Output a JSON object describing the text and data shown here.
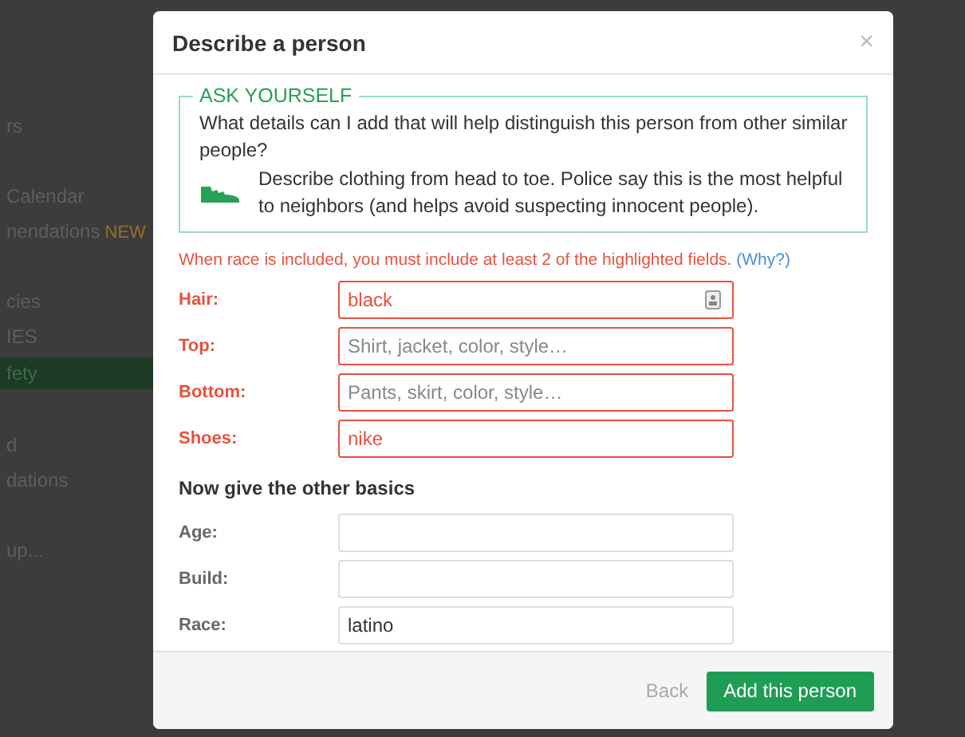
{
  "background_sidebar": {
    "groups": [
      {
        "items": [
          {
            "label": "rs",
            "selected": false
          }
        ]
      },
      {
        "items": [
          {
            "label": "Calendar",
            "selected": false
          },
          {
            "label": "nendations",
            "badge": "NEW",
            "selected": false
          }
        ]
      },
      {
        "items": [
          {
            "label": "cies",
            "selected": false
          },
          {
            "label": "IES",
            "selected": false
          },
          {
            "label": "fety",
            "selected": true
          }
        ]
      },
      {
        "items": [
          {
            "label": "d",
            "selected": false
          },
          {
            "label": "dations",
            "selected": false
          }
        ]
      },
      {
        "items": [
          {
            "label": "up...",
            "selected": false
          }
        ]
      }
    ]
  },
  "dialog": {
    "title": "Describe a person",
    "close": "×",
    "tip": {
      "legend": "ASK YOURSELF",
      "question": "What details can I add that will help distinguish this person from other similar people?",
      "hint": "Describe clothing from head to toe. Police say this is the most helpful to neighbors (and helps avoid suspecting innocent people)."
    },
    "warning": {
      "text": "When race is included, you must include at least 2 of the highlighted fields.",
      "link": "(Why?)"
    },
    "highlighted_fields": [
      {
        "label": "Hair:",
        "value": "black",
        "kind": "autofill",
        "highlighted": true
      },
      {
        "label": "Top:",
        "placeholder": "Shirt, jacket, color, style…",
        "kind": "text",
        "highlighted": true
      },
      {
        "label": "Bottom:",
        "placeholder": "Pants, skirt, color, style…",
        "kind": "text",
        "highlighted": true
      },
      {
        "label": "Shoes:",
        "value": "nike",
        "kind": "text",
        "highlighted": true
      }
    ],
    "basics_heading": "Now give the other basics",
    "basic_fields": [
      {
        "label": "Age:",
        "highlighted": false
      },
      {
        "label": "Build:",
        "highlighted": false
      },
      {
        "label": "Race:",
        "value": "latino",
        "highlighted": false
      }
    ],
    "buttons": [
      {
        "label": "Back",
        "kind": "link"
      },
      {
        "label": "Add this person",
        "kind": "primary"
      }
    ]
  }
}
